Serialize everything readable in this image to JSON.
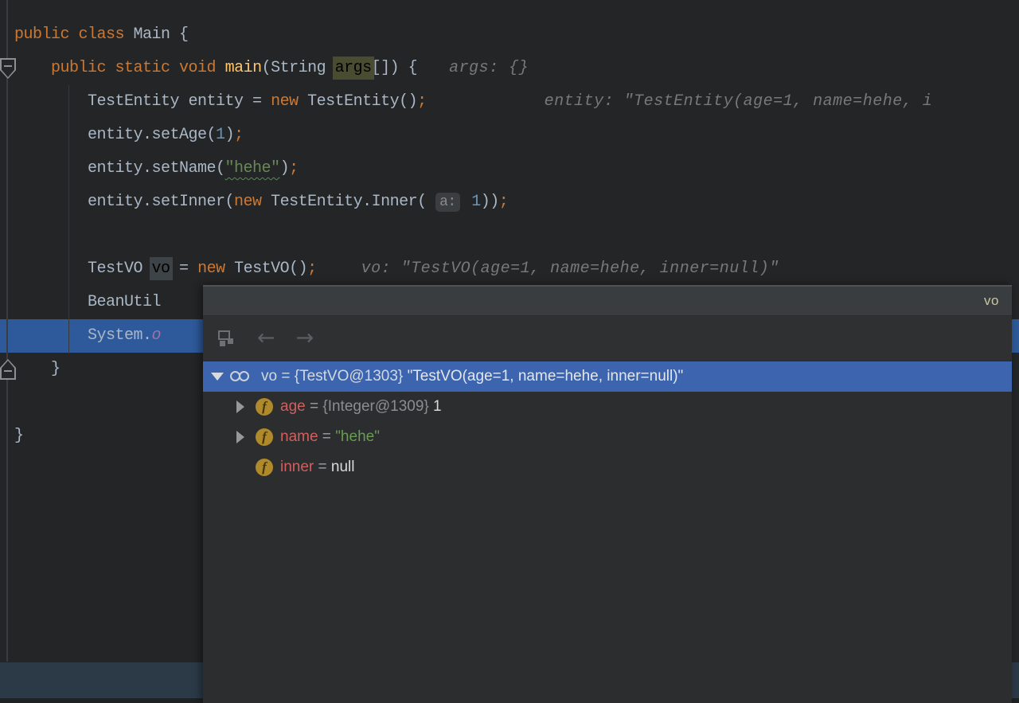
{
  "editor": {
    "lines": [
      {
        "tokens": [
          {
            "c": "kw",
            "t": "public class "
          },
          {
            "c": "plain",
            "t": "Main {"
          }
        ]
      },
      {
        "tokens": [
          {
            "c": "plain",
            "t": "    "
          },
          {
            "c": "kw",
            "t": "public static void "
          },
          {
            "c": "method",
            "t": "main"
          },
          {
            "c": "plain",
            "t": "(String "
          },
          {
            "c": "arg",
            "t": "args"
          },
          {
            "c": "plain",
            "t": "[]) {"
          }
        ],
        "hint": "args: {}"
      },
      {
        "tokens": [
          {
            "c": "plain",
            "t": "        TestEntity entity = "
          },
          {
            "c": "kw",
            "t": "new"
          },
          {
            "c": "plain",
            "t": " TestEntity()"
          },
          {
            "c": "semi",
            "t": ";"
          }
        ],
        "hint": "entity: \"TestEntity(age=1, name=hehe, i"
      },
      {
        "tokens": [
          {
            "c": "plain",
            "t": "        entity.setAge("
          },
          {
            "c": "num",
            "t": "1"
          },
          {
            "c": "plain",
            "t": ")"
          },
          {
            "c": "semi",
            "t": ";"
          }
        ]
      },
      {
        "tokens": [
          {
            "c": "plain",
            "t": "        entity.setName("
          },
          {
            "c": "strw",
            "t": "\"hehe\""
          },
          {
            "c": "plain",
            "t": ")"
          },
          {
            "c": "semi",
            "t": ";"
          }
        ]
      },
      {
        "tokens": [
          {
            "c": "plain",
            "t": "        entity.setInner("
          },
          {
            "c": "kw",
            "t": "new"
          },
          {
            "c": "plain",
            "t": " TestEntity.Inner( "
          },
          {
            "c": "param",
            "t": "a:"
          },
          {
            "c": "num",
            "t": " 1"
          },
          {
            "c": "plain",
            "t": "))"
          },
          {
            "c": "semi",
            "t": ";"
          }
        ]
      },
      {
        "tokens": []
      },
      {
        "tokens": [
          {
            "c": "plain",
            "t": "        TestVO "
          },
          {
            "c": "var",
            "t": "vo"
          },
          {
            "c": "plain",
            "t": " = "
          },
          {
            "c": "kw",
            "t": "new"
          },
          {
            "c": "plain",
            "t": " TestVO()"
          },
          {
            "c": "semi",
            "t": ";"
          }
        ],
        "hint": "vo: \"TestVO(age=1, name=hehe, inner=null)\""
      },
      {
        "tokens": [
          {
            "c": "plain",
            "t": "        BeanUtil"
          }
        ]
      },
      {
        "tokens": [
          {
            "c": "plain",
            "t": "        System."
          },
          {
            "c": "sfield",
            "t": "o"
          }
        ],
        "exec": true
      },
      {
        "tokens": [
          {
            "c": "plain",
            "t": "    }"
          }
        ]
      },
      {
        "tokens": []
      },
      {
        "tokens": [
          {
            "c": "plain",
            "t": "}"
          }
        ]
      }
    ]
  },
  "popup": {
    "title": "vo",
    "toolbar": {
      "back_icon": "←",
      "forward_icon": "→"
    },
    "tree": {
      "field_glyph": "f",
      "rows": [
        {
          "expand": "open",
          "icon": "watch",
          "level": 0,
          "selected": true,
          "name": "vo",
          "sep": " = ",
          "type": "{TestVO@1303} ",
          "value": "\"TestVO(age=1, name=hehe, inner=null)\"",
          "kind": "plain"
        },
        {
          "expand": "closed",
          "icon": "field",
          "level": 1,
          "selected": false,
          "name": "age",
          "sep": " = ",
          "type": "{Integer@1309} ",
          "value": "1",
          "kind": "plain"
        },
        {
          "expand": "closed",
          "icon": "field",
          "level": 1,
          "selected": false,
          "name": "name",
          "sep": " = ",
          "type": "",
          "value": "\"hehe\"",
          "kind": "string"
        },
        {
          "expand": "none",
          "icon": "field",
          "level": 1,
          "selected": false,
          "name": "inner",
          "sep": " = ",
          "type": "",
          "value": "null",
          "kind": "plain"
        }
      ]
    }
  },
  "colors": {
    "editor_background": "#242526",
    "execution_line": "#2E5A9B",
    "selected_row": "#3D64AE",
    "keyword": "#CC7832",
    "string": "#6A8759",
    "number": "#6897BB",
    "field_name": "#CF6060",
    "inline_hint": "#787878",
    "popup_background": "#2B2D2F",
    "popup_header": "#3A3D3F",
    "bottom_bar": "#2C3A48"
  }
}
